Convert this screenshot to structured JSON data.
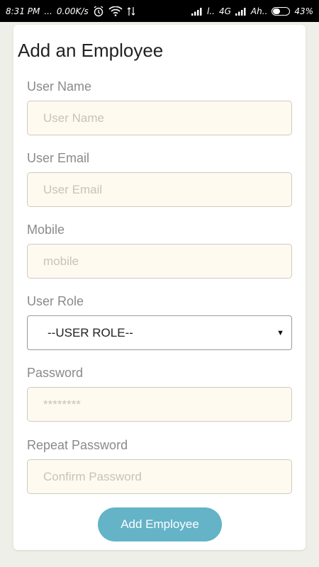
{
  "status_bar": {
    "time": "8:31 PM",
    "dots": "...",
    "speed": "0.00K/s",
    "carrier1": "l..",
    "network": "4G",
    "carrier2": "Ah..",
    "battery_level": 0.43,
    "battery_text": "43%"
  },
  "form": {
    "title": "Add an Employee",
    "fields": {
      "user_name": {
        "label": "User Name",
        "placeholder": "User Name"
      },
      "user_email": {
        "label": "User Email",
        "placeholder": "User Email"
      },
      "mobile": {
        "label": "Mobile",
        "placeholder": "mobile"
      },
      "user_role": {
        "label": "User Role",
        "selected": "--USER ROLE--"
      },
      "password": {
        "label": "Password",
        "placeholder": "********"
      },
      "repeat_password": {
        "label": "Repeat Password",
        "placeholder": "Confirm Password"
      }
    },
    "submit_label": "Add Employee"
  }
}
